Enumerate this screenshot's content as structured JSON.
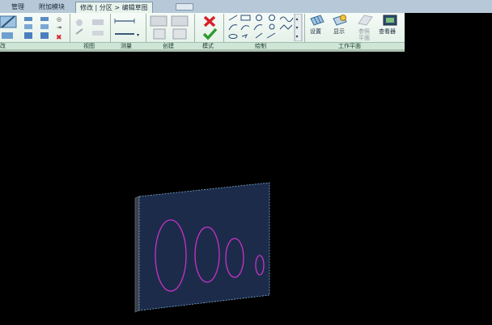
{
  "tabs": [
    {
      "label": "管理"
    },
    {
      "label": "附加模块"
    },
    {
      "label": "修改 | 分区 > 编辑草图"
    }
  ],
  "ribbon": {
    "panels": {
      "modify_partial": "改",
      "view": "视图",
      "measure": "测量",
      "create": "创建",
      "mode": "模式",
      "draw": "绘制",
      "work_plane": "工作平面"
    },
    "work_plane_buttons": {
      "set": "设置",
      "show": "显示",
      "ref_plane_line1": "参照",
      "ref_plane_line2": "平面",
      "viewer": "查看器"
    }
  },
  "colors": {
    "ribbon_bg": "#e1efe6",
    "panel_label_bg": "#cfe6d7",
    "viewport_bg": "#000000",
    "panel_face": "#1c2b4a",
    "sketch_lines": "#c832c8",
    "cancel_red": "#d8202a",
    "finish_green": "#2e9a2e"
  }
}
